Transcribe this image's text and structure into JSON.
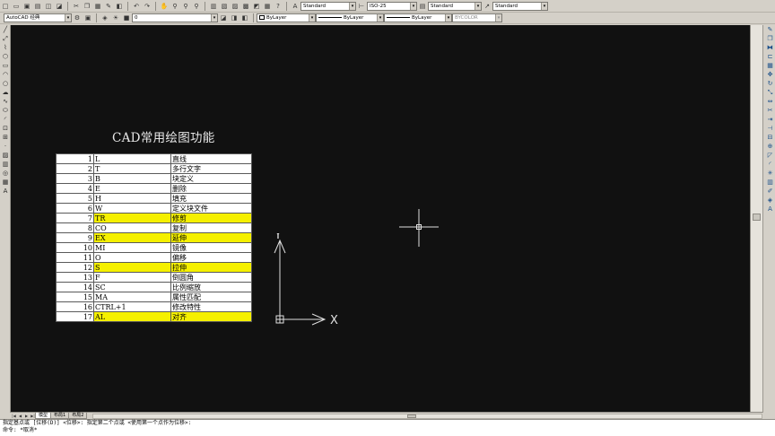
{
  "toolbar": {
    "styles": {
      "text_style": "Standard",
      "dim_style": "ISO-25",
      "table_style": "Standard",
      "multileader_style": "Standard"
    },
    "workspace": "AutoCAD 经典",
    "layer": "0",
    "color": "ByLayer",
    "linetype": "ByLayer",
    "lineweight": "ByLayer",
    "plotstyle": "BYCOLOR"
  },
  "drawing": {
    "title": "CAD常用绘图功能",
    "table": [
      {
        "num": "1",
        "cmd": "L",
        "desc": "直线",
        "hl": false
      },
      {
        "num": "2",
        "cmd": "T",
        "desc": "多行文字",
        "hl": false
      },
      {
        "num": "3",
        "cmd": "B",
        "desc": "块定义",
        "hl": false
      },
      {
        "num": "4",
        "cmd": "E",
        "desc": "删除",
        "hl": false
      },
      {
        "num": "5",
        "cmd": "H",
        "desc": "填充",
        "hl": false
      },
      {
        "num": "6",
        "cmd": "W",
        "desc": "定义块文件",
        "hl": false
      },
      {
        "num": "7",
        "cmd": "TR",
        "desc": "修剪",
        "hl": true
      },
      {
        "num": "8",
        "cmd": "CO",
        "desc": "复制",
        "hl": false
      },
      {
        "num": "9",
        "cmd": "EX",
        "desc": "延伸",
        "hl": true
      },
      {
        "num": "10",
        "cmd": "MI",
        "desc": "镜像",
        "hl": false
      },
      {
        "num": "11",
        "cmd": "O",
        "desc": "偏移",
        "hl": false
      },
      {
        "num": "12",
        "cmd": "S",
        "desc": "拉伸",
        "hl": true
      },
      {
        "num": "13",
        "cmd": "F",
        "desc": "倒圆角",
        "hl": false
      },
      {
        "num": "14",
        "cmd": "SC",
        "desc": "比例缩放",
        "hl": false
      },
      {
        "num": "15",
        "cmd": "MA",
        "desc": "属性匹配",
        "hl": false
      },
      {
        "num": "16",
        "cmd": "CTRL+1",
        "desc": "修改特性",
        "hl": false
      },
      {
        "num": "17",
        "cmd": "AL",
        "desc": "对齐",
        "hl": true
      }
    ],
    "ucs": {
      "x_label": "X",
      "y_label": "Y"
    }
  },
  "layout_tabs": [
    "模型",
    "布局1",
    "布局2"
  ],
  "command_window": {
    "line1": "指定基点或 [位移(D)] <位移>:  指定第二个点或 <使用第一个点作为位移>:",
    "line2": "命令: *取消*"
  },
  "colors": {
    "canvas": "#111111",
    "highlight": "#f5f000",
    "table_bg": "#ffffff",
    "chrome": "#d4d0c8"
  },
  "icons": {
    "left_toolbar": [
      "line-icon",
      "construction-line-icon",
      "polyline-icon",
      "polygon-icon",
      "rectangle-icon",
      "arc-icon",
      "circle-icon",
      "revcloud-icon",
      "spline-icon",
      "ellipse-icon",
      "ellipse-arc-icon",
      "insert-block-icon",
      "make-block-icon",
      "point-icon",
      "hatch-icon",
      "gradient-icon",
      "region-icon",
      "table-icon",
      "multiline-text-icon"
    ],
    "right_toolbar": [
      "erase-icon",
      "copy-icon",
      "mirror-icon",
      "offset-icon",
      "array-icon",
      "move-icon",
      "rotate-icon",
      "scale-icon",
      "stretch-icon",
      "trim-icon",
      "extend-icon",
      "break-at-point-icon",
      "break-icon",
      "join-icon",
      "chamfer-icon",
      "fillet-icon",
      "explode-icon",
      "properties-icon",
      "match-properties-icon",
      "layer-icon",
      "text-style-icon"
    ]
  }
}
